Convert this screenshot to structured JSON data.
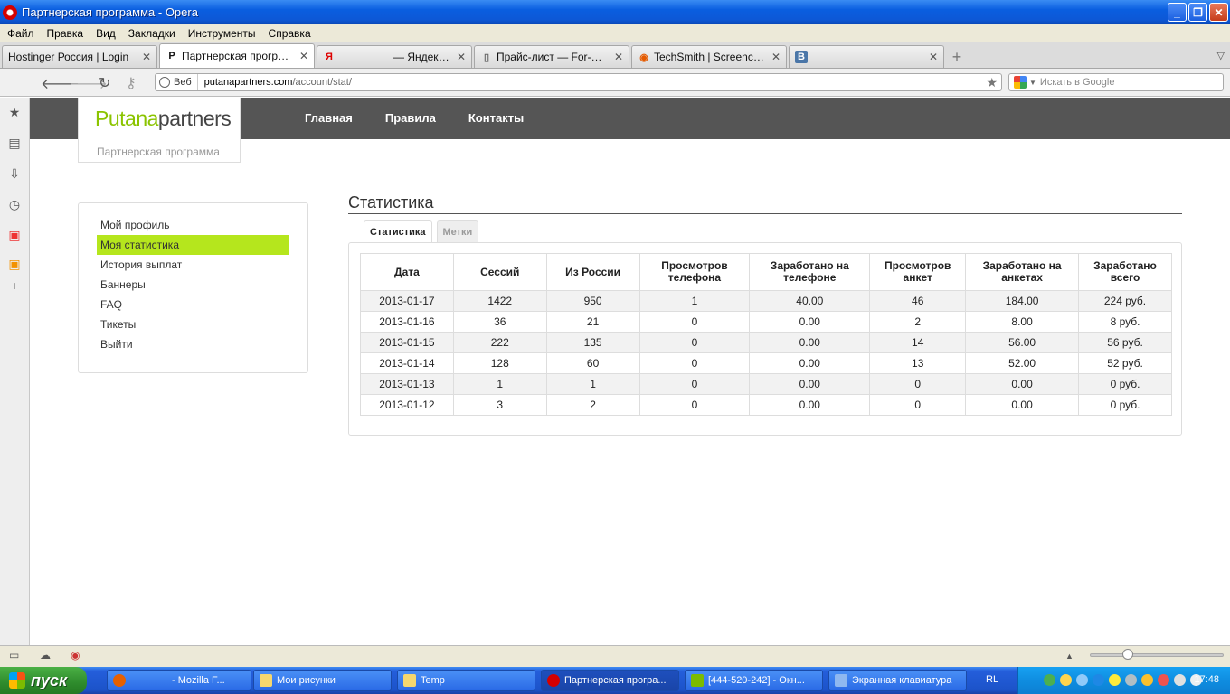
{
  "window": {
    "title": "Партнерская программа - Opera"
  },
  "menu": [
    "Файл",
    "Правка",
    "Вид",
    "Закладки",
    "Инструменты",
    "Справка"
  ],
  "tabs": [
    {
      "label": "Hostinger Россия | Login",
      "active": false
    },
    {
      "label": "Партнерская программа",
      "active": true
    },
    {
      "label": "— Яндекс: на...",
      "active": false
    },
    {
      "label": "Прайс-лист — For-Sleep...",
      "active": false
    },
    {
      "label": "TechSmith | Screencast....",
      "active": false
    },
    {
      "label": "",
      "active": false
    }
  ],
  "address": {
    "badge": "Веб",
    "host": "putanapartners.com",
    "path": "/account/stat/",
    "search_placeholder": "Искать в Google"
  },
  "site": {
    "logo_green": "Putana",
    "logo_dark": "partners",
    "logo_sub": "Партнерская программа",
    "nav": [
      "Главная",
      "Правила",
      "Контакты"
    ]
  },
  "sidebar": {
    "items": [
      "Мой профиль",
      "Моя статистика",
      "История выплат",
      "Баннеры",
      "FAQ",
      "Тикеты",
      "Выйти"
    ],
    "active_index": 1
  },
  "content": {
    "title": "Статистика",
    "subtabs": [
      "Статистика",
      "Метки"
    ],
    "table": {
      "headers": [
        "Дата",
        "Сессий",
        "Из России",
        "Просмотров телефона",
        "Заработано на телефоне",
        "Просмотров анкет",
        "Заработано на анкетах",
        "Заработано всего"
      ],
      "rows": [
        [
          "2013-01-17",
          "1422",
          "950",
          "1",
          "40.00",
          "46",
          "184.00",
          "224 руб."
        ],
        [
          "2013-01-16",
          "36",
          "21",
          "0",
          "0.00",
          "2",
          "8.00",
          "8 руб."
        ],
        [
          "2013-01-15",
          "222",
          "135",
          "0",
          "0.00",
          "14",
          "56.00",
          "56 руб."
        ],
        [
          "2013-01-14",
          "128",
          "60",
          "0",
          "0.00",
          "13",
          "52.00",
          "52 руб."
        ],
        [
          "2013-01-13",
          "1",
          "1",
          "0",
          "0.00",
          "0",
          "0.00",
          "0 руб."
        ],
        [
          "2013-01-12",
          "3",
          "2",
          "0",
          "0.00",
          "0",
          "0.00",
          "0 руб."
        ]
      ]
    }
  },
  "taskbar": {
    "start": "пуск",
    "tasks": [
      {
        "label": "- Mozilla F...",
        "active": false
      },
      {
        "label": "Мои рисунки",
        "active": false
      },
      {
        "label": "Temp",
        "active": false
      },
      {
        "label": "Партнерская програ...",
        "active": true
      },
      {
        "label": "[444-520-242] - Окн...",
        "active": false
      },
      {
        "label": "Экранная клавиатура",
        "active": false
      }
    ],
    "lang": "RL",
    "clock": "17:48"
  },
  "colors": {
    "accent_green": "#8bc400",
    "active_menu": "#b5e61d",
    "header_gray": "#555555"
  }
}
